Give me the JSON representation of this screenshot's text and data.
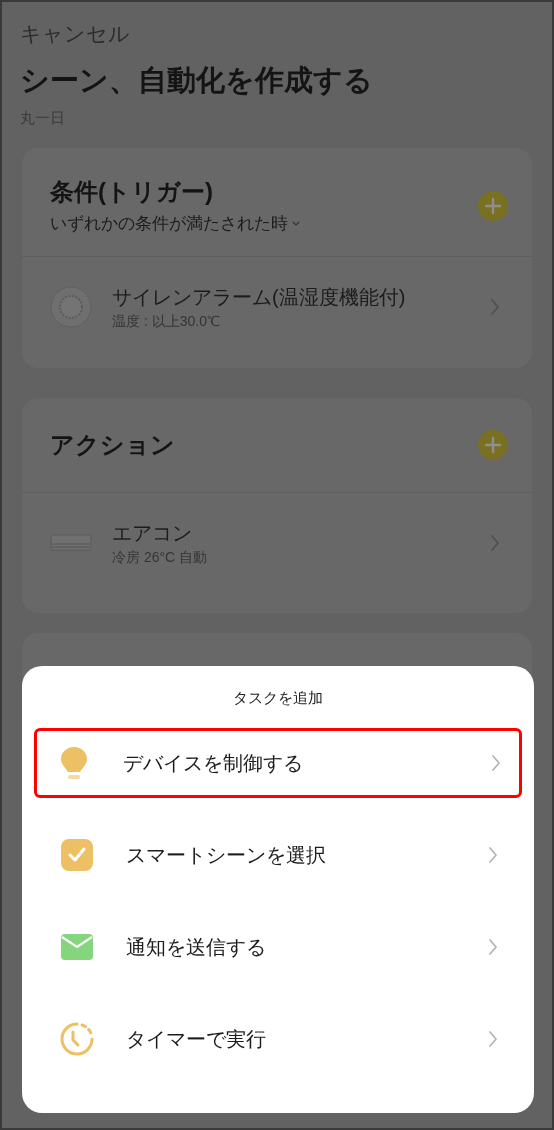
{
  "header": {
    "cancel": "キャンセル",
    "title": "シーン、自動化を作成する",
    "subtitle": "丸一日"
  },
  "condition": {
    "title": "条件(トリガー)",
    "mode": "いずれかの条件が満たされた時",
    "items": [
      {
        "kind": "siren",
        "name": "サイレンアラーム(温湿度機能付)",
        "detail": "温度 : 以上30.0℃"
      }
    ]
  },
  "action": {
    "title": "アクション",
    "items": [
      {
        "kind": "aircon",
        "name": "エアコン",
        "detail": "冷房 26°C 自動"
      }
    ]
  },
  "sheet": {
    "title": "タスクを追加",
    "options": [
      {
        "kind": "bulb",
        "label": "デバイスを制御する",
        "highlighted": true
      },
      {
        "kind": "check",
        "label": "スマートシーンを選択",
        "highlighted": false
      },
      {
        "kind": "mail",
        "label": "通知を送信する",
        "highlighted": false
      },
      {
        "kind": "timer",
        "label": "タイマーで実行",
        "highlighted": false
      }
    ]
  }
}
